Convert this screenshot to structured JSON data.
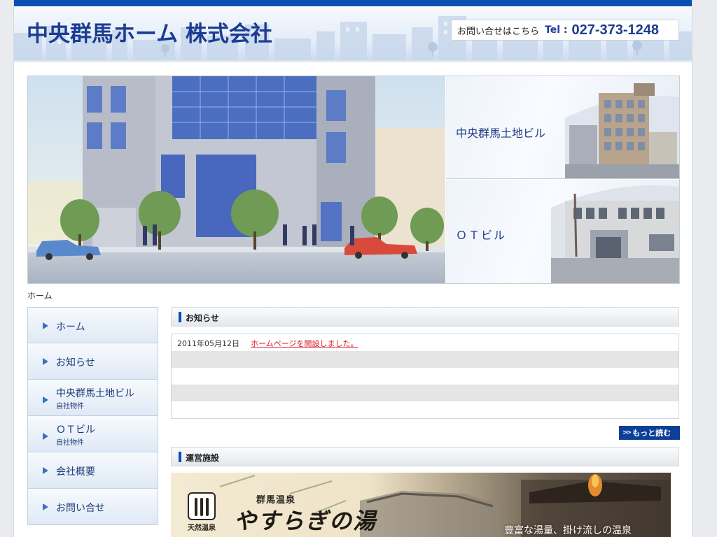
{
  "header": {
    "site_title": "中央群馬ホーム 株式会社",
    "contact_label": "お問い合せはこちら",
    "tel_prefix": "Tel :",
    "tel_number": "027-373-1248"
  },
  "hero": {
    "side_links": [
      {
        "label": "中央群馬土地ビル"
      },
      {
        "label": "ＯＴビル"
      }
    ]
  },
  "breadcrumb": "ホーム",
  "nav": {
    "items": [
      {
        "label": "ホーム",
        "sub": ""
      },
      {
        "label": "お知らせ",
        "sub": ""
      },
      {
        "label": "中央群馬土地ビル",
        "sub": "自社物件"
      },
      {
        "label": "ＯＴビル",
        "sub": "自社物件"
      },
      {
        "label": "会社概要",
        "sub": ""
      },
      {
        "label": "お問い合せ",
        "sub": ""
      }
    ]
  },
  "news": {
    "title": "お知らせ",
    "rows": [
      {
        "date": "2011年05月12日",
        "text": "ホームページを開設しました。"
      }
    ],
    "more_label": "もっと読む",
    "more_mark": ">>"
  },
  "facility": {
    "title": "運営施設",
    "banner": {
      "sub": "群馬温泉",
      "name": "やすらぎの湯",
      "badge": "天然温泉",
      "slogan": "豊富な湯量、掛け流しの温泉"
    }
  },
  "colors": {
    "brand_blue": "#0b4fb0",
    "title_navy": "#1b3c92",
    "news_link_red": "#d61d2c"
  }
}
